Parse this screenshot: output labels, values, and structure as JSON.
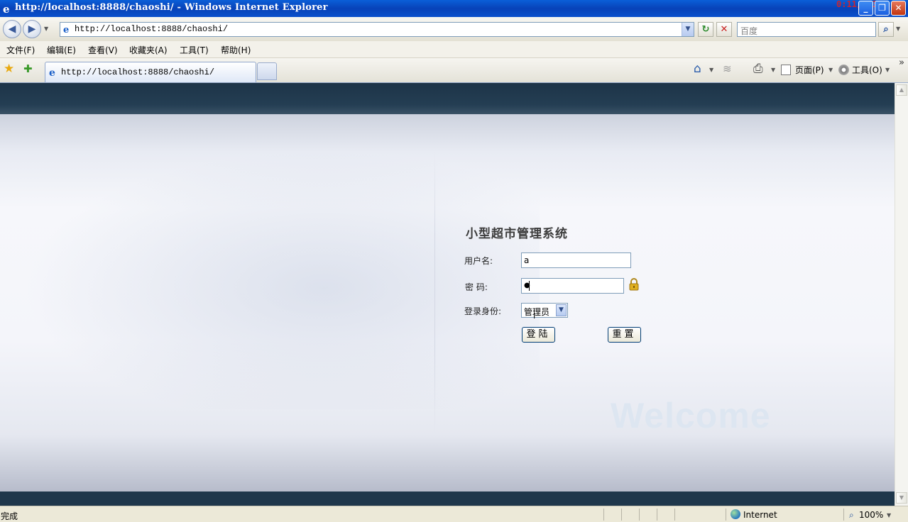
{
  "window": {
    "title": "http://localhost:8888/chaoshi/ - Windows Internet Explorer",
    "clock": "0:11/2:30",
    "minimize_glyph": "_",
    "restore_glyph": "❐",
    "close_glyph": "✕"
  },
  "addressbar": {
    "url": "http://localhost:8888/chaoshi/",
    "search_placeholder": "百度",
    "back_glyph": "◀",
    "forward_glyph": "▶",
    "dropdown_glyph": "▼",
    "refresh_glyph": "↻",
    "stop_glyph": "✕",
    "search_glyph": "⌕"
  },
  "menu": {
    "items": [
      "文件(F)",
      "编辑(E)",
      "查看(V)",
      "收藏夹(A)",
      "工具(T)",
      "帮助(H)"
    ]
  },
  "tabs": {
    "active_label": "http://localhost:8888/chaoshi/",
    "favorites_glyph": "★",
    "add_favorites_glyph": "✚",
    "home_glyph": "⌂",
    "feeds_glyph": "≋",
    "print_glyph": "⎙",
    "page_menu": "页面(P)",
    "tools_menu": "工具(O)",
    "more_glyph": "»"
  },
  "login": {
    "system_title": "小型超市管理系统",
    "username_label": "用户名:",
    "username_value": "a",
    "password_label": "密 码:",
    "password_value": "●",
    "role_label": "登录身份:",
    "role_value": "管理员",
    "login_button": "登陆",
    "reset_button": "重置",
    "welcome_text": "Welcome"
  },
  "statusbar": {
    "status": "完成",
    "zone": "Internet",
    "zoom": "100%"
  },
  "colors": {
    "title_bar": "#0842b8",
    "header_band": "#1d3448",
    "lock_icon": "#e0b020"
  }
}
